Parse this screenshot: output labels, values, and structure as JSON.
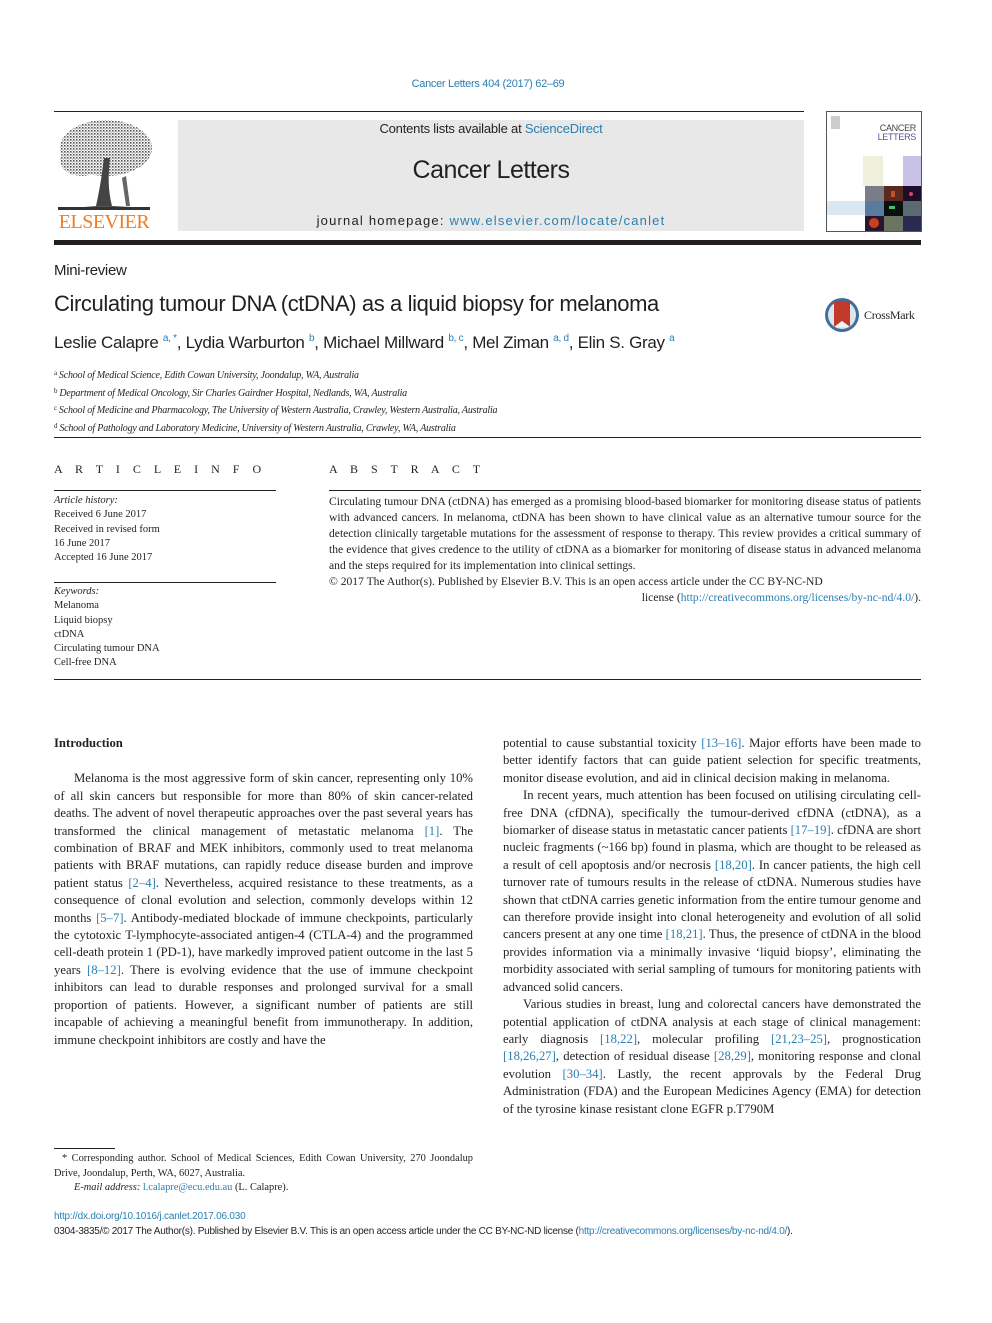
{
  "header": {
    "journal_ref": "Cancer Letters 404 (2017) 62–69",
    "contents_prefix": "Contents lists available at ",
    "contents_link": "ScienceDirect",
    "journal_name": "Cancer Letters",
    "homepage_prefix": "journal homepage: ",
    "homepage_link": "www.elsevier.com/locate/canlet",
    "publisher_logo_text": "ELSEVIER",
    "cover_title_line1": "CANCER",
    "cover_title_line2": "LETTERS",
    "colors": {
      "link": "#2a7fb0",
      "elsevier_orange": "#f47c20",
      "masthead_bg": "#e8e8e8"
    }
  },
  "article": {
    "type": "Mini-review",
    "title": "Circulating tumour DNA (ctDNA) as a liquid biopsy for melanoma",
    "crossmark_label": "CrossMark",
    "authors": [
      {
        "name": "Leslie Calapre",
        "sup": "a, *",
        "sep": ", "
      },
      {
        "name": "Lydia Warburton",
        "sup": "b",
        "sep": ", "
      },
      {
        "name": "Michael Millward",
        "sup": "b, c",
        "sep": ", "
      },
      {
        "name": "Mel Ziman",
        "sup": "a, d",
        "sep": ", "
      },
      {
        "name": "Elin S. Gray",
        "sup": "a",
        "sep": ""
      }
    ],
    "affiliations": [
      {
        "key": "a",
        "text": "School of Medical Science, Edith Cowan University, Joondalup, WA, Australia"
      },
      {
        "key": "b",
        "text": "Department of Medical Oncology, Sir Charles Gairdner Hospital, Nedlands, WA, Australia"
      },
      {
        "key": "c",
        "text": "School of Medicine and Pharmacology, The University of Western Australia, Crawley, Western Australia, Australia"
      },
      {
        "key": "d",
        "text": "School of Pathology and Laboratory Medicine, University of Western Australia, Crawley, WA, Australia"
      }
    ]
  },
  "article_info": {
    "heading": "A R T I C L E   I N F O",
    "history_label": "Article history:",
    "history": [
      "Received 6 June 2017",
      "Received in revised form",
      "16 June 2017",
      "Accepted 16 June 2017"
    ],
    "keywords_label": "Keywords:",
    "keywords": [
      "Melanoma",
      "Liquid biopsy",
      "ctDNA",
      "Circulating tumour DNA",
      "Cell-free DNA"
    ]
  },
  "abstract": {
    "heading": "A B S T R A C T",
    "text": "Circulating tumour DNA (ctDNA) has emerged as a promising blood-based biomarker for monitoring disease status of patients with advanced cancers. In melanoma, ctDNA has been shown to have clinical value as an alternative tumour source for the detection clinically targetable mutations for the assessment of response to therapy. This review provides a critical summary of the evidence that gives credence to the utility of ctDNA as a biomarker for monitoring of disease status in advanced melanoma and the steps required for its implementation into clinical settings.",
    "copyright": "© 2017 The Author(s). Published by Elsevier B.V. This is an open access article under the CC BY-NC-ND",
    "license_prefix": "license (",
    "license_link": "http://creativecommons.org/licenses/by-nc-nd/4.0/",
    "license_suffix": ")."
  },
  "body": {
    "intro_heading": "Introduction",
    "left_paragraphs": [
      [
        {
          "t": "Melanoma is the most aggressive form of skin cancer, representing only 10% of all skin cancers but responsible for more than 80% of skin cancer-related deaths. The advent of novel therapeutic approaches over the past several years has transformed the clinical management of metastatic melanoma "
        },
        {
          "c": "[1]"
        },
        {
          "t": ". The combination of BRAF and MEK inhibitors, commonly used to treat melanoma patients with BRAF mutations, can rapidly reduce disease burden and improve patient status "
        },
        {
          "c": "[2–4]"
        },
        {
          "t": ". Nevertheless, acquired resistance to these treatments, as a consequence of clonal evolution and selection, commonly develops within 12 months "
        },
        {
          "c": "[5–7]"
        },
        {
          "t": ". Antibody-mediated blockade of immune checkpoints, particularly the cytotoxic T-lymphocyte-associated antigen-4 (CTLA-4) and the programmed cell-death protein 1 (PD-1), have markedly improved patient outcome in the last 5 years "
        },
        {
          "c": "[8–12]"
        },
        {
          "t": ". There is evolving evidence that the use of immune checkpoint inhibitors can lead to durable responses and prolonged survival for a small proportion of patients. However, a significant number of patients are still incapable of achieving a meaningful benefit from immunotherapy. In addition, immune checkpoint inhibitors are costly and have the"
        }
      ]
    ],
    "right_paragraphs": [
      [
        {
          "t": "potential to cause substantial toxicity "
        },
        {
          "c": "[13–16]"
        },
        {
          "t": ". Major efforts have been made to better identify factors that can guide patient selection for specific treatments, monitor disease evolution, and aid in clinical decision making in melanoma."
        }
      ],
      [
        {
          "t": "In recent years, much attention has been focused on utilising circulating cell-free DNA (cfDNA), specifically the tumour-derived cfDNA (ctDNA), as a biomarker of disease status in metastatic cancer patients "
        },
        {
          "c": "[17–19]"
        },
        {
          "t": ". cfDNA are short nucleic fragments (~166 bp) found in plasma, which are thought to be released as a result of cell apoptosis and/or necrosis "
        },
        {
          "c": "[18,20]"
        },
        {
          "t": ". In cancer patients, the high cell turnover rate of tumours results in the release of ctDNA. Numerous studies have shown that ctDNA carries genetic information from the entire tumour genome and can therefore provide insight into clonal heterogeneity and evolution of all solid cancers present at any one time "
        },
        {
          "c": "[18,21]"
        },
        {
          "t": ". Thus, the presence of ctDNA in the blood provides information via a minimally invasive ‘liquid biopsy’, eliminating the morbidity associated with serial sampling of tumours for monitoring patients with advanced solid cancers."
        }
      ],
      [
        {
          "t": "Various studies in breast, lung and colorectal cancers have demonstrated the potential application of ctDNA analysis at each stage of clinical management: early diagnosis "
        },
        {
          "c": "[18,22]"
        },
        {
          "t": ", molecular profiling "
        },
        {
          "c": "[21,23–25]"
        },
        {
          "t": ", prognostication "
        },
        {
          "c": "[18,26,27]"
        },
        {
          "t": ", detection of residual disease "
        },
        {
          "c": "[28,29]"
        },
        {
          "t": ", monitoring response and clonal evolution "
        },
        {
          "c": "[30–34]"
        },
        {
          "t": ". Lastly, the recent approvals by the Federal Drug Administration (FDA) and the European Medicines Agency (EMA) for detection of the tyrosine kinase resistant clone EGFR p.T790M"
        }
      ]
    ]
  },
  "footnote": {
    "star": "*",
    "corresponding": " Corresponding author. School of Medical Sciences, Edith Cowan University, 270 Joondalup Drive, Joondalup, Perth, WA, 6027, Australia.",
    "email_label": "E-mail address:",
    "email": "l.calapre@ecu.edu.au",
    "email_suffix": " (L. Calapre)."
  },
  "footer": {
    "doi": "http://dx.doi.org/10.1016/j.canlet.2017.06.030",
    "copyright_prefix": "0304-3835/© 2017 The Author(s). Published by Elsevier B.V. This is an open access article under the CC BY-NC-ND license (",
    "license_link": "http://creativecommons.org/licenses/by-nc-nd/4.0/",
    "copyright_suffix": ")."
  }
}
